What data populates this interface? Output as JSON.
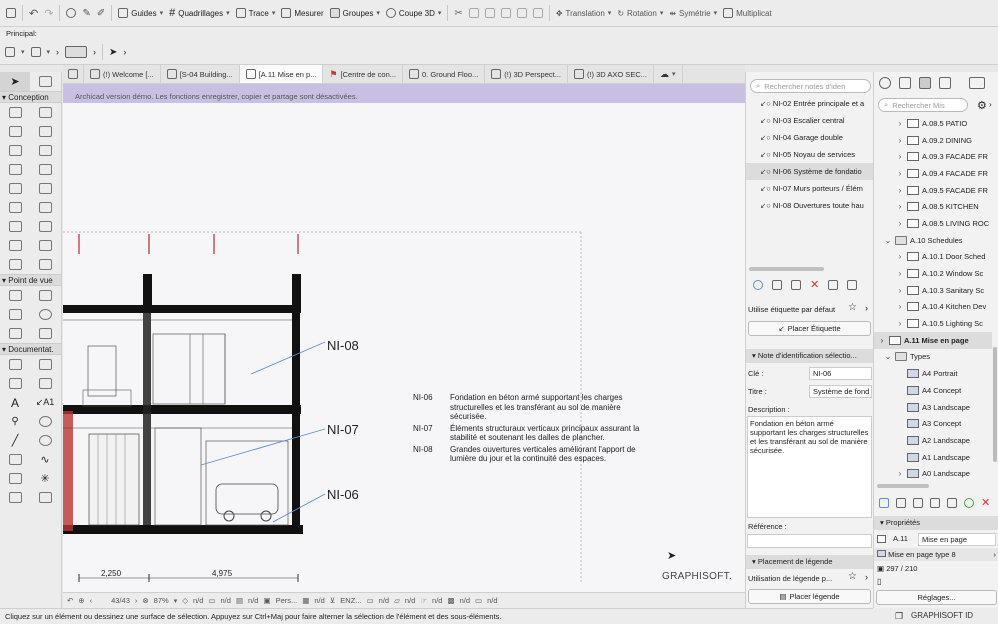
{
  "toolbar": {
    "guides": "Guides",
    "grids": "Quadrillages",
    "trace": "Trace",
    "measure": "Mesurer",
    "groups": "Groupes",
    "section3d": "Coupe 3D",
    "translation": "Translation",
    "rotation": "Rotation",
    "symmetry": "Symétrie",
    "multiply": "Multiplicat"
  },
  "toolbar2": {
    "principal": "Principal:"
  },
  "palette": {
    "conception": "Conception",
    "viewpoint": "Point de vue",
    "documentation": "Documentat."
  },
  "tabs": [
    {
      "label": "(!) Welcome [..."
    },
    {
      "label": "[S-04 Building..."
    },
    {
      "label": "[A.11 Mise en p..."
    },
    {
      "label": "[Centre de con..."
    },
    {
      "label": "0. Ground Floo..."
    },
    {
      "label": "(!) 3D Perspect..."
    },
    {
      "label": "(!) 3D AXO SEC..."
    }
  ],
  "canvas": {
    "banner": "Archicad version démo. Les fonctions enregistrer, copier et partage sont désactivées.",
    "labels": [
      "NI-08",
      "NI-07",
      "NI-06"
    ],
    "dims": [
      "2,250",
      "4,975"
    ],
    "legend": [
      {
        "key": "NI-06",
        "text": [
          "Fondation en béton armé supportant les charges",
          "structurelles et les transférant au sol de manière",
          "sécurisée."
        ]
      },
      {
        "key": "NI-07",
        "text": [
          "Éléments structuraux verticaux principaux assurant la",
          "stabilité et soutenant les dalles de plancher."
        ]
      },
      {
        "key": "NI-08",
        "text": [
          "Grandes ouvertures verticales améliorant l'apport de",
          "lumière du jour et la continuité des espaces."
        ]
      }
    ],
    "brand": "GRAPHISOFT."
  },
  "viewbar": {
    "page": "43/43",
    "zoom": "87%",
    "nd": "n/d",
    "pers": "Pers...",
    "enz": "ENZ..."
  },
  "status": "Cliquez sur un élément ou dessinez une surface de sélection. Appuyez sur Ctrl+Maj pour faire alterner la sélection de l'élément et des sous-éléments.",
  "notes": {
    "search_placeholder": "Rechercher notes d'iden",
    "items": [
      {
        "label": "NI-02 Entrée principale et a"
      },
      {
        "label": "NI-03 Escalier central"
      },
      {
        "label": "NI-04 Garage double"
      },
      {
        "label": "NI-05 Noyau de services"
      },
      {
        "label": "NI-06 Système de fondatio"
      },
      {
        "label": "NI-07 Murs porteurs / Élém"
      },
      {
        "label": "NI-08 Ouvertures toute hau"
      }
    ],
    "default_label": "Utilise étiquette par défaut",
    "place_label": "Placer Étiquette",
    "section_id": "Note d'identification sélectio...",
    "key_label": "Clé :",
    "key_value": "NI-06",
    "title_label": "Titre :",
    "title_value": "Système de fond",
    "desc_label": "Description :",
    "desc_value": "Fondation en béton armé supportant les charges structurelles et les transférant au sol de manière sécurisée.",
    "ref_label": "Référence :",
    "section_legend": "Placement de légende",
    "use_legend": "Utilisation de légende p...",
    "place_legend": "Placer légende"
  },
  "navigator": {
    "search_placeholder": "Rechercher Mis",
    "items": [
      {
        "label": "A.08.5 PATIO",
        "level": 2,
        "kind": "layout"
      },
      {
        "label": "A.09.2 DINING",
        "level": 2,
        "kind": "layout"
      },
      {
        "label": "A.09.3 FACADE FR",
        "level": 2,
        "kind": "layout"
      },
      {
        "label": "A.09.4 FACADE FR",
        "level": 2,
        "kind": "layout"
      },
      {
        "label": "A.09.5 FACADE FR",
        "level": 2,
        "kind": "layout"
      },
      {
        "label": "A.08.5 KITCHEN",
        "level": 2,
        "kind": "layout"
      },
      {
        "label": "A.08.5 LIVING ROC",
        "level": 2,
        "kind": "layout"
      },
      {
        "label": "A.10 Schedules",
        "level": 1,
        "kind": "folder"
      },
      {
        "label": "A.10.1 Door Sched",
        "level": 2,
        "kind": "layout"
      },
      {
        "label": "A.10.2 Window Sc",
        "level": 2,
        "kind": "layout"
      },
      {
        "label": "A.10.3 Sanitary Sc",
        "level": 2,
        "kind": "layout"
      },
      {
        "label": "A.10.4 Kitchen Dev",
        "level": 2,
        "kind": "layout"
      },
      {
        "label": "A.10.5 Lighting Sc",
        "level": 2,
        "kind": "layout"
      },
      {
        "label": "A.11 Mise en page",
        "level": 0,
        "kind": "layout"
      },
      {
        "label": "Types",
        "level": 1,
        "kind": "folder"
      },
      {
        "label": "A4 Portrait",
        "level": 2,
        "kind": "master"
      },
      {
        "label": "A4 Concept",
        "level": 2,
        "kind": "master"
      },
      {
        "label": "A3 Landscape",
        "level": 2,
        "kind": "master"
      },
      {
        "label": "A3 Concept",
        "level": 2,
        "kind": "master"
      },
      {
        "label": "A2 Landscape",
        "level": 2,
        "kind": "master"
      },
      {
        "label": "A1 Landscape",
        "level": 2,
        "kind": "master"
      },
      {
        "label": "A0 Landscape",
        "level": 2,
        "kind": "master"
      }
    ],
    "props_head": "Propriétés",
    "prop_id": "A.11",
    "prop_name": "Mise en page",
    "prop_type": "Mise en page type 8",
    "prop_size": "297 / 210",
    "settings": "Réglages...",
    "brand": "GRAPHISOFT ID"
  },
  "colors": {
    "accent": "#5b8fd6",
    "banner": "#c9bfe3"
  }
}
